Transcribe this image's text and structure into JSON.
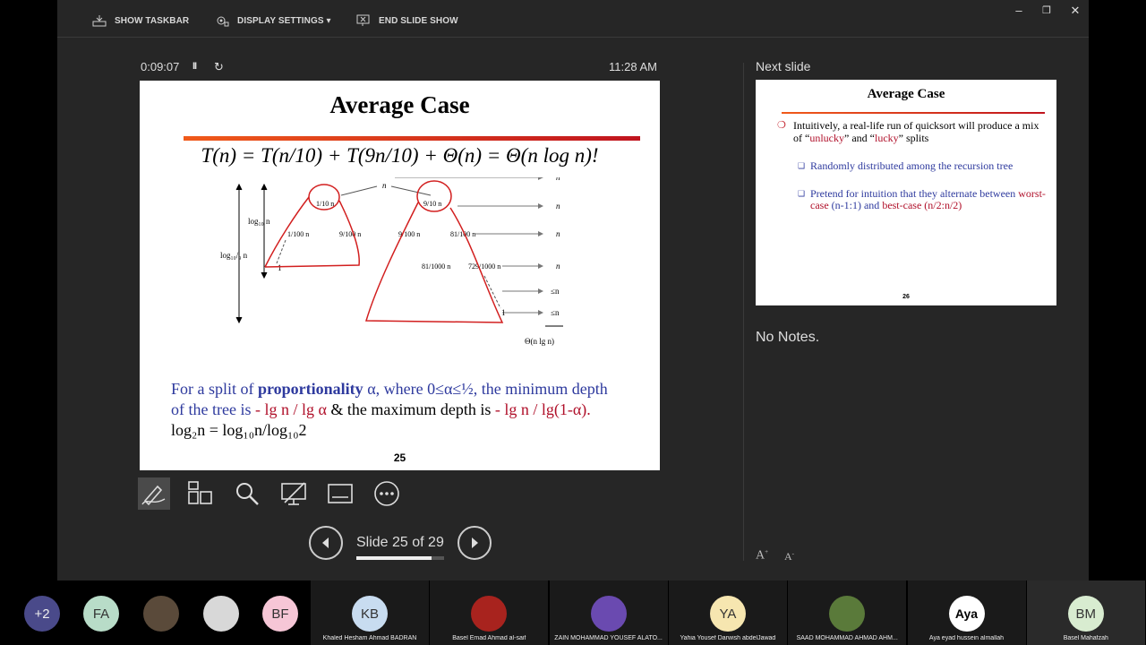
{
  "toolbar": {
    "show_taskbar": "SHOW TASKBAR",
    "display_settings": "DISPLAY SETTINGS ▾",
    "end_slide_show": "END SLIDE SHOW"
  },
  "window": {
    "minimize": "–",
    "restore": "❐",
    "close": "✕"
  },
  "timer": {
    "elapsed": "0:09:07",
    "pause": "II",
    "reset": "↻"
  },
  "clock": "11:28 AM",
  "current_slide": {
    "title": "Average Case",
    "formula": "T(n) = T(n/10) + T(9n/10) + Θ(n) = Θ(n log n)!",
    "para_1_a": "For a split of ",
    "para_1_b": "proportionality",
    "para_1_c": " α, where 0≤α≤½, the minimum depth",
    "para_2_a": "of the tree is ",
    "para_2_b": " - lg n / lg α ",
    "para_2_c": " & the maximum depth is ",
    "para_2_d": " - lg n / lg(1-α).",
    "para_3": "log₂n = log₁₀n/log₁₀2",
    "page_number": "25",
    "tree_labels": {
      "n_top": "n",
      "n_row": [
        "n",
        "n",
        "n",
        "n"
      ],
      "le_n": [
        "≤n",
        "≤n"
      ],
      "total": "Θ(n lg n)",
      "log10n": "log₁₀ n",
      "log109n": "log₁₀/₉ n",
      "one_left": "1",
      "one_right": "1",
      "frac_1_10": "1/10 n",
      "frac_9_10": "9/10 n",
      "frac_1_100": "1/100 n",
      "frac_9_100_a": "9/100 n",
      "frac_9_100_b": "9/100 n",
      "frac_81_100": "81/100 n",
      "frac_81_1000": "81/1000 n",
      "frac_729_1000": "729/1000 n"
    }
  },
  "tools": [
    "pen-tool",
    "see-all-slides",
    "zoom",
    "black-screen",
    "subtitles",
    "more-options"
  ],
  "navigation": {
    "counter": "Slide 25 of 29",
    "progress": 0.862
  },
  "next_panel": {
    "label": "Next slide",
    "title": "Average Case",
    "bullet_1_a": "Intuitively, a real-life run of quicksort will produce a mix of “",
    "bullet_1_b": "unlucky",
    "bullet_1_c": "” and “",
    "bullet_1_d": "lucky",
    "bullet_1_e": "” splits",
    "sub_1": "Randomly distributed among the recursion tree",
    "sub_2_a": "Pretend for intuition that they alternate between ",
    "sub_2_b": "worst-case",
    "sub_2_c": " (n-1:1) and ",
    "sub_2_d": "best-case",
    "sub_2_e": " (n/2:n/2)",
    "page_number": "26"
  },
  "notes": "No Notes.",
  "font_controls": {
    "increase": "A",
    "decrease": "A"
  },
  "participants": [
    {
      "initials": "+2",
      "color": "#4a4a8a"
    },
    {
      "initials": "FA",
      "color": "#b8dcc8"
    },
    {
      "initials": "",
      "color": "#5a4a3a"
    },
    {
      "initials": "",
      "color": "#d8d8d8"
    },
    {
      "initials": "BF",
      "color": "#f6c6d6"
    },
    {
      "initials": "KB",
      "name": "Khaled Hesham Ahmad BADRAN",
      "color": "#c8dcf0"
    },
    {
      "initials": "",
      "name": "Basel Emad Ahmad al-saif",
      "color": "#a8231e"
    },
    {
      "initials": "",
      "name": "ZAIN MOHAMMAD YOUSEF ALATO...",
      "color": "#6a4ab0"
    },
    {
      "initials": "YA",
      "name": "Yahia Yousef Darwish abdelJawad",
      "color": "#f6e6b0"
    },
    {
      "initials": "",
      "name": "SAAD MOHAMMAD AHMAD AHM...",
      "color": "#5a7a3a"
    },
    {
      "initials": "Aya",
      "name": "Aya eyad hussein almallah",
      "color": "#ffffff"
    },
    {
      "initials": "BM",
      "name": "Basel Mahafzah",
      "color": "#d8ecd0"
    }
  ]
}
